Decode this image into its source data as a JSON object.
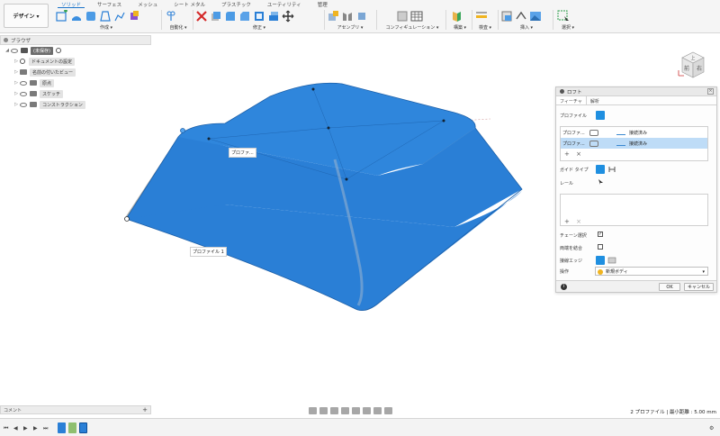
{
  "toolbar": {
    "workspace": "デザイン ▾",
    "tabs": [
      "ソリッド",
      "サーフェス",
      "メッシュ",
      "シート メタル",
      "プラスチック",
      "ユーティリティ",
      "管理"
    ],
    "groups": {
      "create": "作成 ▾",
      "automate": "自動化 ▾",
      "modify": "修正 ▾",
      "assemble": "アセンブリ ▾",
      "configure": "コンフィギュレーション ▾",
      "construct": "構築 ▾",
      "inspect": "検査 ▾",
      "insert": "挿入 ▾",
      "select": "選択 ▾"
    }
  },
  "browser": {
    "title": "ブラウザ",
    "items": [
      {
        "label": "(未保存)"
      },
      {
        "label": "ドキュメントの設定"
      },
      {
        "label": "名前の付いたビュー"
      },
      {
        "label": "原点"
      },
      {
        "label": "スケッチ"
      },
      {
        "label": "コンストラクション"
      }
    ]
  },
  "viewcube": {
    "front": "前",
    "right": "右",
    "top": "上"
  },
  "viewport": {
    "callout_profile_short": "プロファ...",
    "callout_profile_1": "プロファイル 1"
  },
  "loft": {
    "title": "ロフト",
    "tabs": [
      "フィーチャ",
      "解析"
    ],
    "profile_label": "プロファイル",
    "profiles": [
      {
        "name": "プロファ...",
        "continuity": "接続済み"
      },
      {
        "name": "プロファ...",
        "continuity": "接続済み"
      }
    ],
    "guide_type_label": "ガイド タイプ",
    "rail_label": "レール",
    "chain_select_label": "チェーン選択",
    "merge_tangent_label": "両端を結合",
    "tangent_edges_label": "接線エッジ",
    "operation_label": "操作",
    "operation_value": "新規ボディ",
    "ok": "OK",
    "cancel": "キャンセル"
  },
  "comments": {
    "label": "コメント"
  },
  "status": {
    "text": "2 プロファイル | 最小距離 : 5.00 mm"
  },
  "colors": {
    "body_blue": "#2a7fd6",
    "accent": "#1f8fe0",
    "surface_gray": "#b5b5b0"
  }
}
